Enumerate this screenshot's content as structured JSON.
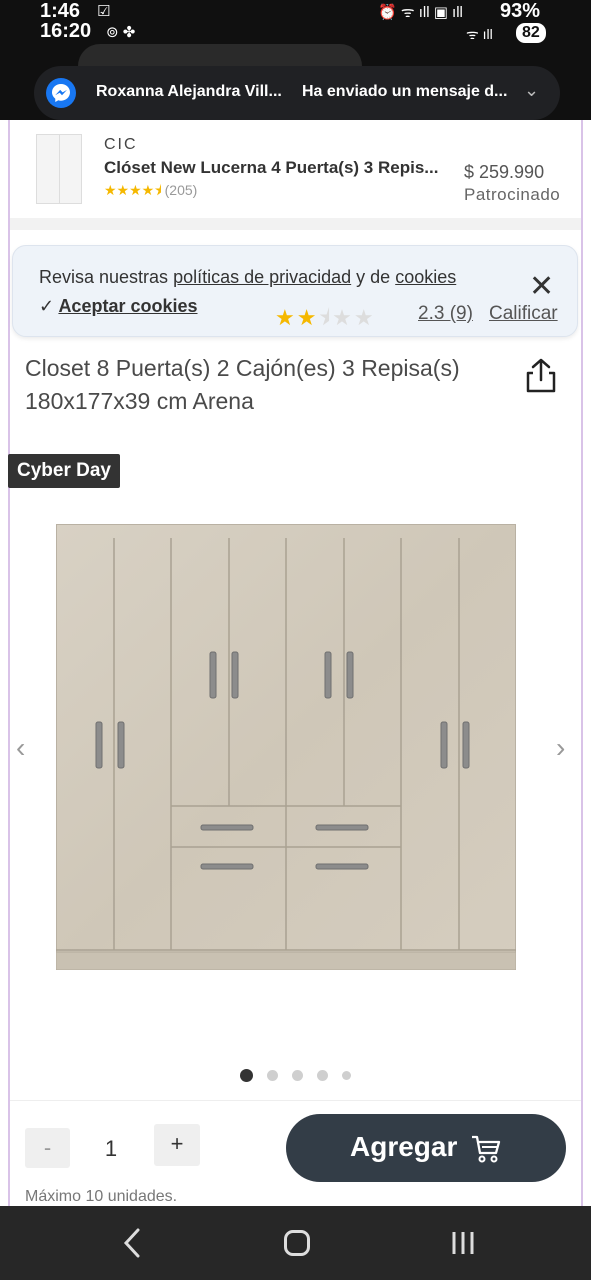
{
  "status_bar": {
    "time_top": "1:46",
    "time_bottom": "16:20",
    "battery_top": "93%",
    "battery_bottom": "82"
  },
  "notification": {
    "sender": "Roxanna Alejandra Vill...",
    "message": "Ha enviado un mensaje d...",
    "app_icon": "messenger-icon"
  },
  "sponsored": {
    "brand": "CIC",
    "name": "Clóset New Lucerna 4 Puerta(s) 3 Repis...",
    "rating_stars": 4.5,
    "rating_count": "(205)",
    "price": "$ 259.990",
    "tag": "Patrocinado"
  },
  "cookie_banner": {
    "text_prefix": "Revisa nuestras ",
    "privacy_link": "políticas de privacidad",
    "text_middle": " y de ",
    "cookies_link": "cookies",
    "accept_label": "Aceptar cookies",
    "close_icon": "close-icon"
  },
  "rating": {
    "stars": 2.3,
    "summary": "2.3 (9)",
    "rate_label": "Calificar"
  },
  "product": {
    "title": "Closet 8 Puerta(s) 2 Cajón(es) 3 Repisa(s) 180x177x39 cm Arena",
    "badge": "Cyber Day",
    "image_count": 5,
    "active_image": 1
  },
  "purchase": {
    "minus_label": "-",
    "quantity": "1",
    "plus_label": "+",
    "max_text": "Máximo 10 unidades.",
    "add_label": "Agregar"
  },
  "colors": {
    "cta_bg": "#333d47",
    "star": "#f5b800",
    "badge_bg": "#333333"
  }
}
